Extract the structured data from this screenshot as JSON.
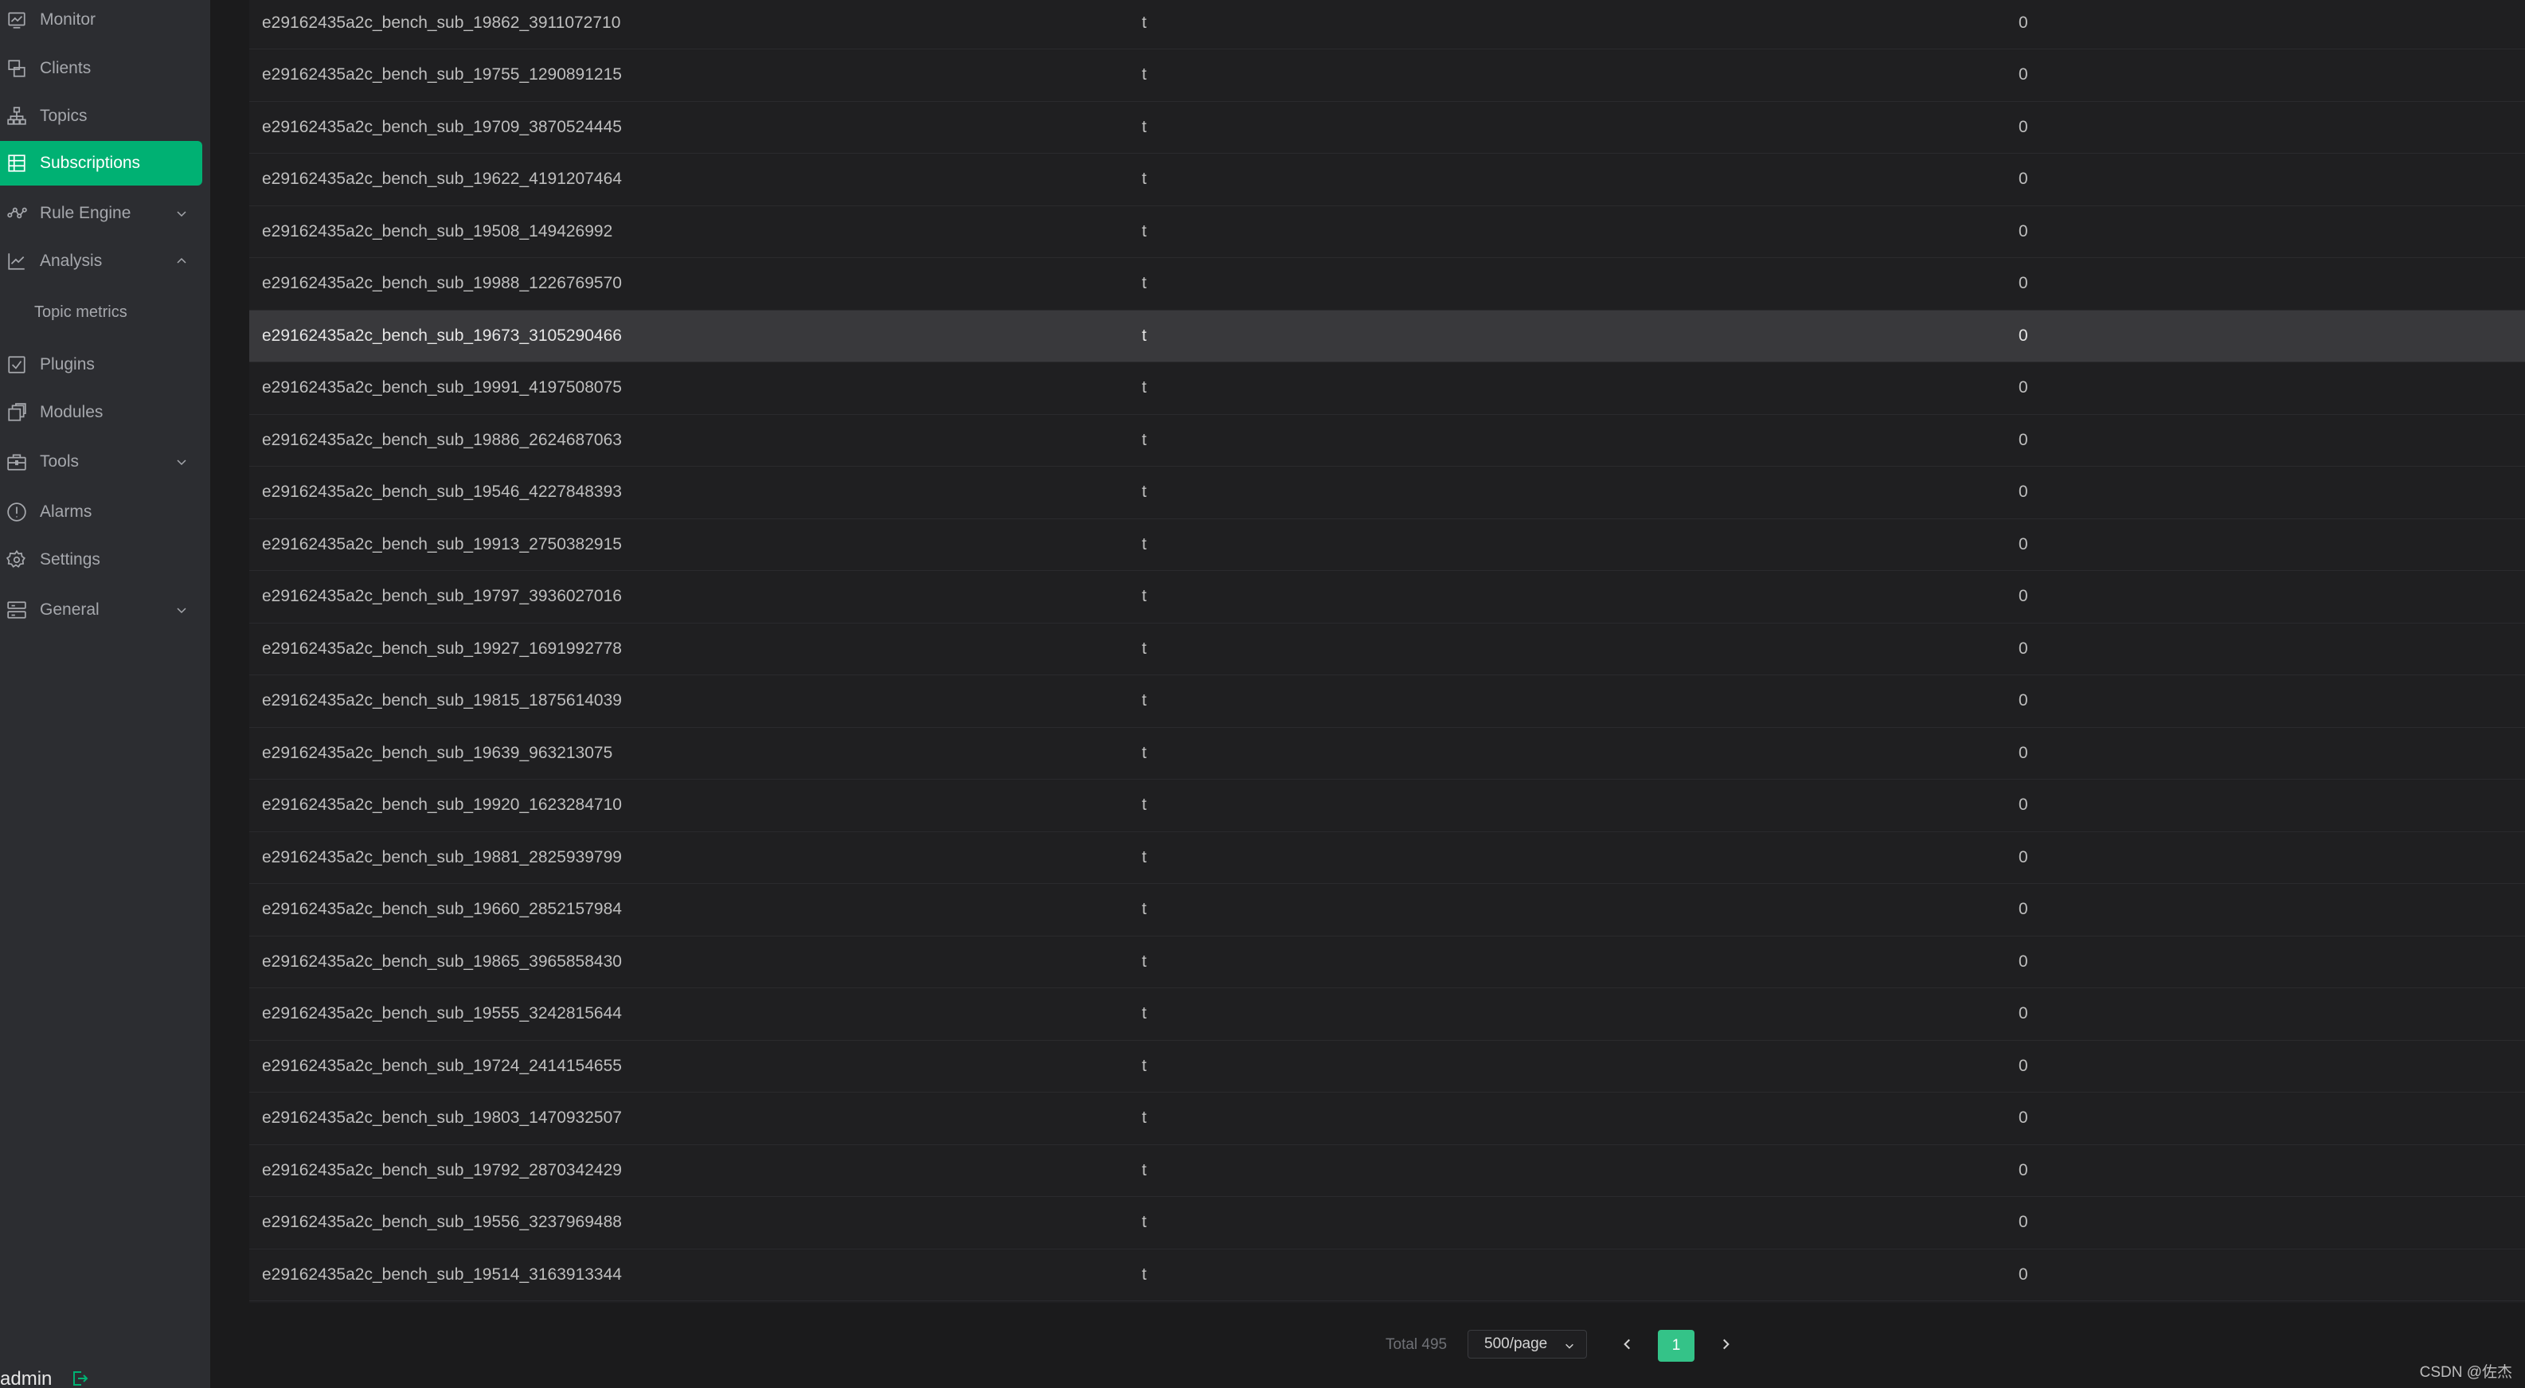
{
  "sidebar": {
    "items": [
      {
        "label": "Monitor",
        "icon": "monitor-icon"
      },
      {
        "label": "Clients",
        "icon": "clients-icon"
      },
      {
        "label": "Topics",
        "icon": "topics-icon"
      },
      {
        "label": "Subscriptions",
        "icon": "subscriptions-icon",
        "active": true
      },
      {
        "label": "Rule Engine",
        "icon": "rule-engine-icon",
        "chevron": "chevron-down-icon"
      },
      {
        "label": "Analysis",
        "icon": "analysis-icon",
        "chevron": "chevron-up-icon"
      },
      {
        "label": "Plugins",
        "icon": "plugins-icon"
      },
      {
        "label": "Modules",
        "icon": "modules-icon"
      },
      {
        "label": "Tools",
        "icon": "tools-icon",
        "chevron": "chevron-down-icon"
      },
      {
        "label": "Alarms",
        "icon": "alarms-icon"
      },
      {
        "label": "Settings",
        "icon": "settings-icon"
      },
      {
        "label": "General",
        "icon": "general-icon",
        "chevron": "chevron-down-icon"
      }
    ],
    "analysis_sub": "Topic metrics",
    "user": "admin",
    "accent_color": "#00b173"
  },
  "table": {
    "rows": [
      {
        "client": "e29162435a2c_bench_sub_19862_3911072710",
        "topic": "t",
        "qos": "0"
      },
      {
        "client": "e29162435a2c_bench_sub_19755_1290891215",
        "topic": "t",
        "qos": "0"
      },
      {
        "client": "e29162435a2c_bench_sub_19709_3870524445",
        "topic": "t",
        "qos": "0"
      },
      {
        "client": "e29162435a2c_bench_sub_19622_4191207464",
        "topic": "t",
        "qos": "0"
      },
      {
        "client": "e29162435a2c_bench_sub_19508_149426992",
        "topic": "t",
        "qos": "0"
      },
      {
        "client": "e29162435a2c_bench_sub_19988_1226769570",
        "topic": "t",
        "qos": "0"
      },
      {
        "client": "e29162435a2c_bench_sub_19673_3105290466",
        "topic": "t",
        "qos": "0",
        "hovered": true
      },
      {
        "client": "e29162435a2c_bench_sub_19991_4197508075",
        "topic": "t",
        "qos": "0"
      },
      {
        "client": "e29162435a2c_bench_sub_19886_2624687063",
        "topic": "t",
        "qos": "0"
      },
      {
        "client": "e29162435a2c_bench_sub_19546_4227848393",
        "topic": "t",
        "qos": "0"
      },
      {
        "client": "e29162435a2c_bench_sub_19913_2750382915",
        "topic": "t",
        "qos": "0"
      },
      {
        "client": "e29162435a2c_bench_sub_19797_3936027016",
        "topic": "t",
        "qos": "0"
      },
      {
        "client": "e29162435a2c_bench_sub_19927_1691992778",
        "topic": "t",
        "qos": "0"
      },
      {
        "client": "e29162435a2c_bench_sub_19815_1875614039",
        "topic": "t",
        "qos": "0"
      },
      {
        "client": "e29162435a2c_bench_sub_19639_963213075",
        "topic": "t",
        "qos": "0"
      },
      {
        "client": "e29162435a2c_bench_sub_19920_1623284710",
        "topic": "t",
        "qos": "0"
      },
      {
        "client": "e29162435a2c_bench_sub_19881_2825939799",
        "topic": "t",
        "qos": "0"
      },
      {
        "client": "e29162435a2c_bench_sub_19660_2852157984",
        "topic": "t",
        "qos": "0"
      },
      {
        "client": "e29162435a2c_bench_sub_19865_3965858430",
        "topic": "t",
        "qos": "0"
      },
      {
        "client": "e29162435a2c_bench_sub_19555_3242815644",
        "topic": "t",
        "qos": "0"
      },
      {
        "client": "e29162435a2c_bench_sub_19724_2414154655",
        "topic": "t",
        "qos": "0"
      },
      {
        "client": "e29162435a2c_bench_sub_19803_1470932507",
        "topic": "t",
        "qos": "0"
      },
      {
        "client": "e29162435a2c_bench_sub_19792_2870342429",
        "topic": "t",
        "qos": "0"
      },
      {
        "client": "e29162435a2c_bench_sub_19556_3237969488",
        "topic": "t",
        "qos": "0"
      },
      {
        "client": "e29162435a2c_bench_sub_19514_3163913344",
        "topic": "t",
        "qos": "0"
      }
    ]
  },
  "pagination": {
    "total": "Total 495",
    "page_size": "500/page",
    "current_page": "1",
    "active_color": "#34c388"
  },
  "watermark": "CSDN @佐杰"
}
